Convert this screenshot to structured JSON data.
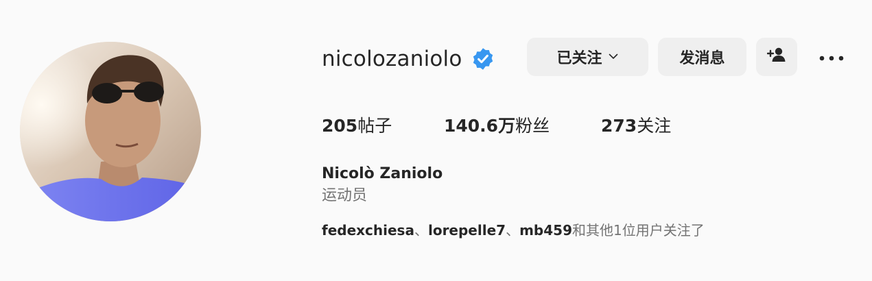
{
  "profile": {
    "username": "nicolozaniolo",
    "verified_icon": "verified-badge-icon",
    "accent_color": "#3897f0",
    "full_name": "Nicolò Zaniolo",
    "category": "运动员"
  },
  "actions": {
    "following_label": "已关注",
    "following_icon": "chevron-down-icon",
    "message_label": "发消息",
    "add_user_icon": "add-user-icon",
    "more_icon": "more-horizontal-icon"
  },
  "stats": {
    "posts": {
      "value": "205",
      "label": "帖子"
    },
    "followers": {
      "value": "140.6万",
      "label": "粉丝"
    },
    "following": {
      "value": "273",
      "label": "关注"
    }
  },
  "followed_by": {
    "names": [
      "fedexchiesa",
      "lorepelle7",
      "mb459"
    ],
    "separator": "、",
    "suffix": "和其他1位用户关注了"
  }
}
